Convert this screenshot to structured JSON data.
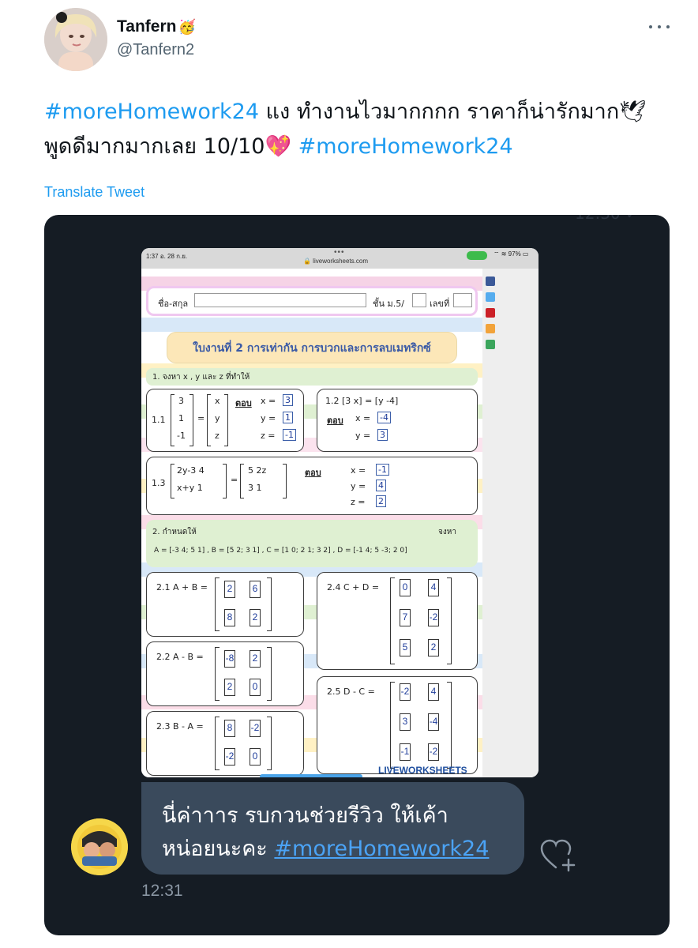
{
  "user": {
    "display_name": "Tanfern",
    "display_emoji": "🥳",
    "handle": "@Tanfern2"
  },
  "tweet": {
    "hashtag_1": "#moreHomework24",
    "text_1": " แง ทำงานไวมากกกก ราคาก็น่ารักมาก🕊",
    "text_2": "พูดดีมากมากเลย 10/10💖 ",
    "hashtag_2": "#moreHomework24",
    "translate_label": "Translate Tweet"
  },
  "media": {
    "top_faint_text": "12:30 ✓",
    "status_time": "1:37  อ. 28 ก.ย.",
    "status_dots": "•••",
    "status_url": "🔒 liveworksheets.com",
    "status_battery": "⌔ ≋ 97% ▭",
    "worksheet": {
      "name_label": "ชื่อ-สกุล",
      "class_label": "ชั้น ม.5/",
      "number_label": "เลขที่",
      "title": "ใบงานที่ 2 การเท่ากัน การบวกและการลบเมทริกซ์",
      "section1_label": "1. จงหา x , y และ z ที่ทำให้",
      "q1_1": {
        "label": "1.1",
        "left": [
          "3",
          "1",
          "-1"
        ],
        "right": [
          "x",
          "y",
          "z"
        ],
        "answer_label": "ตอบ",
        "answers": [
          "x =",
          "y =",
          "z ="
        ],
        "values": [
          "3",
          "1",
          "-1"
        ]
      },
      "q1_2": {
        "label": "1.2 [3  x] = [y  -4]",
        "answer_label": "ตอบ",
        "answers": [
          "x =",
          "y ="
        ],
        "values": [
          "-4",
          "3"
        ]
      },
      "q1_3": {
        "label": "1.3",
        "m1": [
          "2y-3  4",
          "x+y   1"
        ],
        "m2": [
          "5  2z",
          "3   1"
        ],
        "answer_label": "ตอบ",
        "answers": [
          "x =",
          "y =",
          "z ="
        ],
        "values": [
          "-1",
          "4",
          "2"
        ]
      },
      "section2_label": "2. กำหนดให้",
      "section2_defs": "A = [-3 4; 5 1] ,  B = [5 2; 3 1] ,  C = [1 0; 2 1; 3 2] ,  D = [-1 4; 5 -3; 2 0]",
      "section2_find": "จงหา",
      "q2_1": {
        "label": "2.1 A + B =",
        "values": [
          "2",
          "6",
          "8",
          "2"
        ]
      },
      "q2_2": {
        "label": "2.2 A - B =",
        "values": [
          "-8",
          "2",
          "2",
          "0"
        ]
      },
      "q2_3": {
        "label": "2.3 B - A =",
        "values": [
          "8",
          "-2",
          "-2",
          "0"
        ]
      },
      "q2_4": {
        "label": "2.4 C + D =",
        "values": [
          "0",
          "4",
          "7",
          "-2",
          "5",
          "2"
        ]
      },
      "q2_5": {
        "label": "2.5 D - C =",
        "values": [
          "-2",
          "4",
          "3",
          "-4",
          "-1",
          "-2"
        ]
      },
      "logo": "LIVEWORKSHEETS"
    },
    "chat": {
      "message_line_1": "นี่ค่าาาร รบกวนช่วยรีวิว ให้เค้า",
      "message_line_2": "หน่อยนะคะ ",
      "hashtag": "#moreHomework24",
      "time": "12:31"
    }
  },
  "colors": {
    "link": "#1d9bf0",
    "media_bg": "#151c24",
    "bubble_bg": "#3a4a5c",
    "chat_link": "#4ba3f5"
  }
}
